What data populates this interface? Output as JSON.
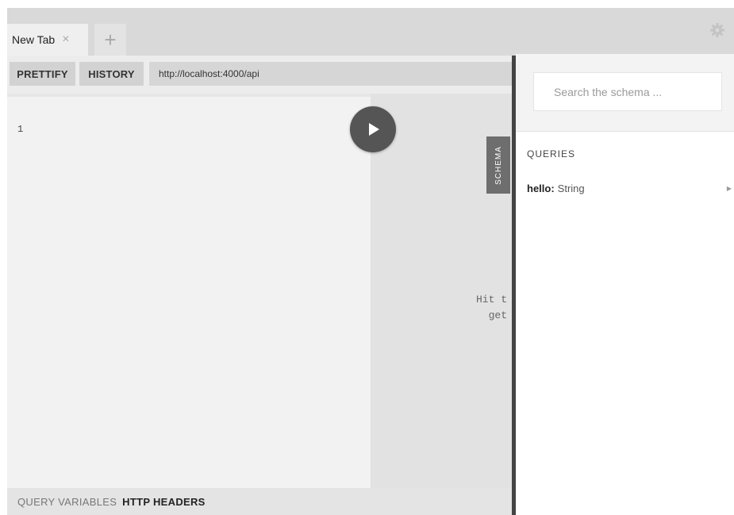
{
  "tabs": [
    {
      "title": "New Tab",
      "close": "×"
    }
  ],
  "add_tab": "+",
  "toolbar": {
    "prettify": "PRETTIFY",
    "history": "HISTORY",
    "endpoint": "http://localhost:4000/api"
  },
  "editor": {
    "line_number": "1"
  },
  "result": {
    "hint": "Hit t\nget"
  },
  "schema_tab": "SCHEMA",
  "bottom": {
    "query_variables": "QUERY VARIABLES",
    "http_headers": "HTTP HEADERS"
  },
  "schema_panel": {
    "search_placeholder": "Search the schema ...",
    "section": "QUERIES",
    "fields": [
      {
        "name": "hello:",
        "type": "String"
      }
    ]
  },
  "colors": {
    "run_button": "#555555",
    "divider": "#444444",
    "schema_tab": "#6e6e6e"
  },
  "icons": {
    "settings": "gear-icon",
    "run": "play-icon",
    "expand": "chevron-right-icon"
  }
}
